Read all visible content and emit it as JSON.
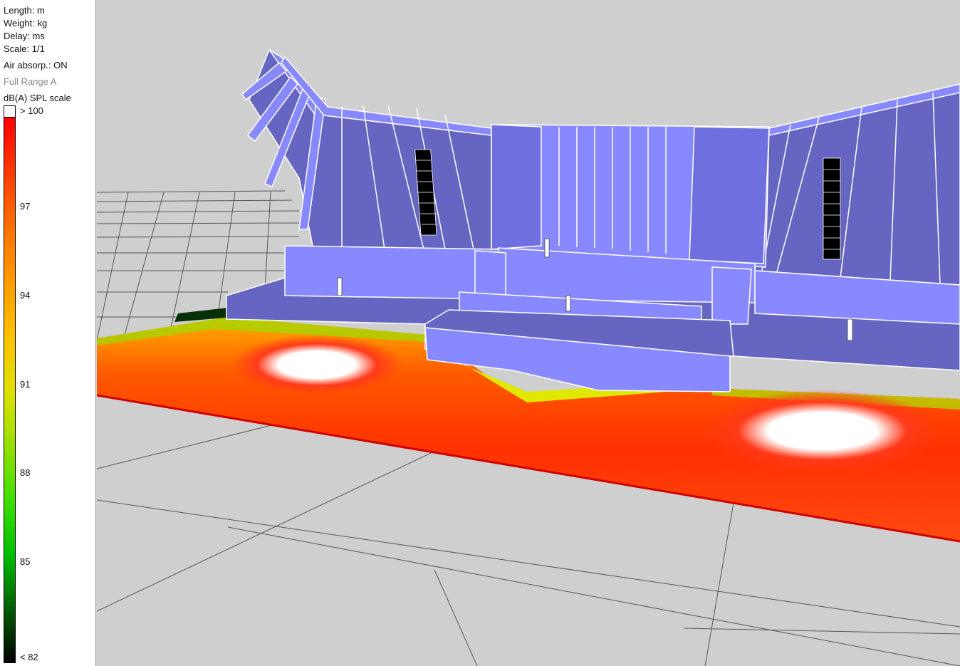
{
  "info": {
    "length": "Length: m",
    "weight": "Weight: kg",
    "delay": "Delay: ms",
    "scale": "Scale: 1/1",
    "air": "Air absorp.: ON",
    "range": "Full Range A",
    "spl_title": "dB(A) SPL scale"
  },
  "scale": {
    "top": "> 100",
    "bottom": "< 82",
    "ticks": [
      "97",
      "94",
      "91",
      "88",
      "85"
    ]
  },
  "colors": {
    "background": "#cfcfcf",
    "stage_light": "#8888ff",
    "stage_dark": "#6666c2",
    "spl_hot": "#ff2a00"
  }
}
